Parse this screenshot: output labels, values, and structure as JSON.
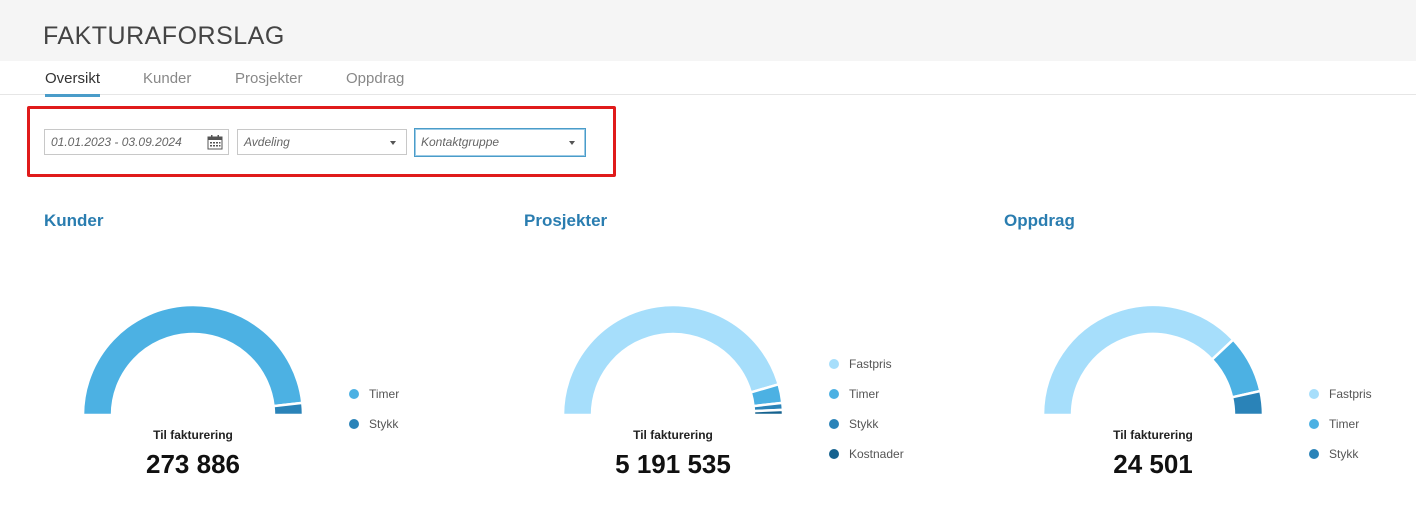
{
  "header": {
    "title": "FAKTURAFORSLAG"
  },
  "tabs": [
    {
      "label": "Oversikt",
      "active": true
    },
    {
      "label": "Kunder",
      "active": false
    },
    {
      "label": "Prosjekter",
      "active": false
    },
    {
      "label": "Oppdrag",
      "active": false
    }
  ],
  "filters": {
    "date_range": "01.01.2023 - 03.09.2024",
    "avdeling_placeholder": "Avdeling",
    "kontaktgruppe_placeholder": "Kontaktgruppe",
    "highlight_color": "#e01b1b"
  },
  "colors": {
    "fastpris": "#a6defb",
    "timer": "#4cb1e3",
    "stykk": "#2a83b8",
    "kostnader": "#15628f",
    "title": "#2a7db0"
  },
  "sections": [
    {
      "title": "Kunder",
      "total_label": "Til fakturering",
      "total_value": "273 886",
      "segments": [
        {
          "name": "Timer",
          "fraction": 0.965,
          "color": "#4cb1e3"
        },
        {
          "name": "Stykk",
          "fraction": 0.035,
          "color": "#2a83b8"
        }
      ],
      "legend": [
        {
          "label": "Timer",
          "color": "#4cb1e3"
        },
        {
          "label": "Stykk",
          "color": "#2a83b8"
        }
      ]
    },
    {
      "title": "Prosjekter",
      "total_label": "Til fakturering",
      "total_value": "5 191 535",
      "segments": [
        {
          "name": "Fastpris",
          "fraction": 0.91,
          "color": "#a6defb"
        },
        {
          "name": "Timer",
          "fraction": 0.055,
          "color": "#4cb1e3"
        },
        {
          "name": "Stykk",
          "fraction": 0.02,
          "color": "#2a83b8"
        },
        {
          "name": "Kostnader",
          "fraction": 0.015,
          "color": "#15628f"
        }
      ],
      "legend": [
        {
          "label": "Fastpris",
          "color": "#a6defb"
        },
        {
          "label": "Timer",
          "color": "#4cb1e3"
        },
        {
          "label": "Stykk",
          "color": "#2a83b8"
        },
        {
          "label": "Kostnader",
          "color": "#15628f"
        }
      ]
    },
    {
      "title": "Oppdrag",
      "total_label": "Til fakturering",
      "total_value": "24 501",
      "segments": [
        {
          "name": "Fastpris",
          "fraction": 0.76,
          "color": "#a6defb"
        },
        {
          "name": "Timer",
          "fraction": 0.17,
          "color": "#4cb1e3"
        },
        {
          "name": "Stykk",
          "fraction": 0.07,
          "color": "#2a83b8"
        }
      ],
      "legend": [
        {
          "label": "Fastpris",
          "color": "#a6defb"
        },
        {
          "label": "Timer",
          "color": "#4cb1e3"
        },
        {
          "label": "Stykk",
          "color": "#2a83b8"
        }
      ]
    }
  ]
}
